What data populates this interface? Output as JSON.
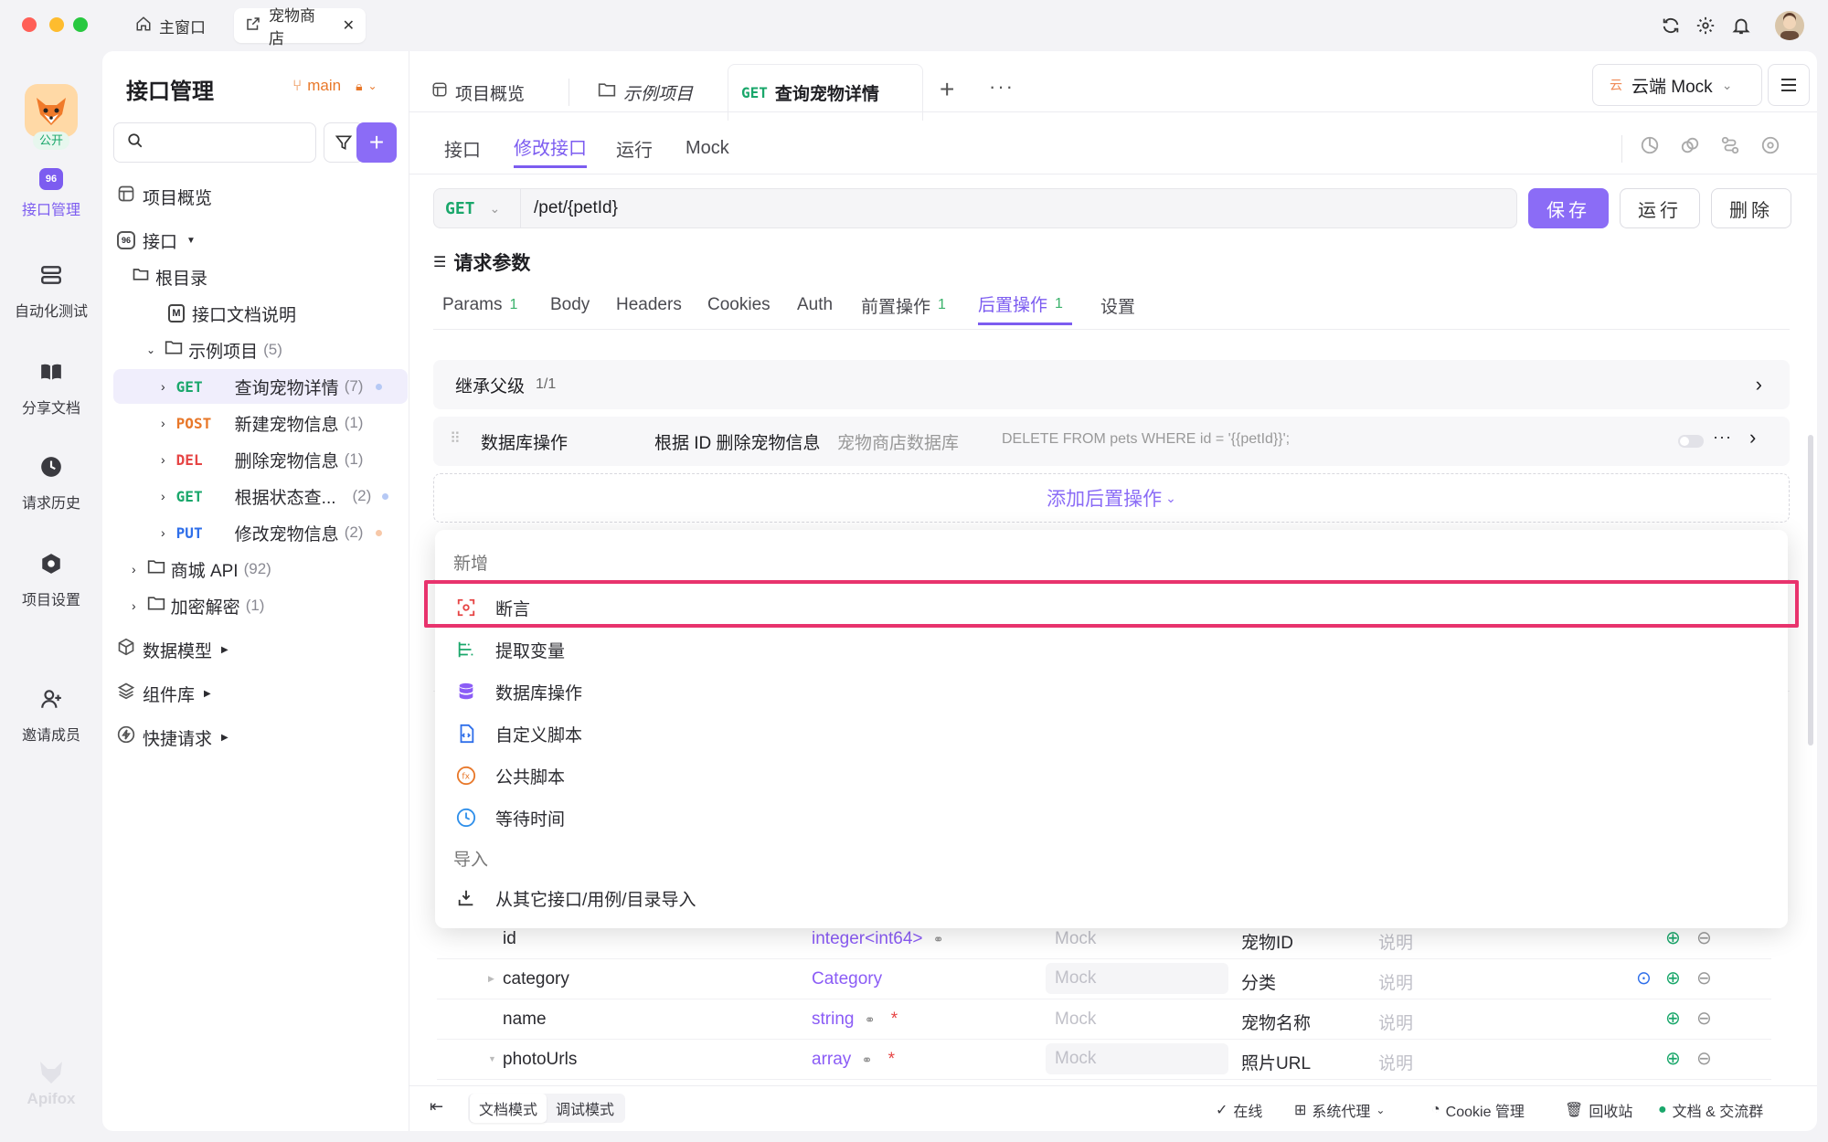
{
  "titlebar": {
    "tabs": [
      {
        "label": "主窗口",
        "icon": "home-icon"
      },
      {
        "label": "宠物商店",
        "icon": "external-link-icon",
        "active": true
      }
    ],
    "right_icons": [
      "refresh-icon",
      "gear-icon",
      "bell-icon",
      "avatar"
    ]
  },
  "rail": {
    "project_badge": "公开",
    "items": [
      {
        "label": "接口管理",
        "icon": "api-icon",
        "active": true
      },
      {
        "label": "自动化测试",
        "icon": "automation-icon"
      },
      {
        "label": "分享文档",
        "icon": "book-icon"
      },
      {
        "label": "请求历史",
        "icon": "clock-icon"
      },
      {
        "label": "项目设置",
        "icon": "settings-icon"
      },
      {
        "label": "邀请成员",
        "icon": "add-user-icon"
      }
    ],
    "brand": "Apifox"
  },
  "sidebar": {
    "title": "接口管理",
    "branch": "main",
    "search_placeholder": "",
    "tree": {
      "overview": "项目概览",
      "interfaces": "接口",
      "root": "根目录",
      "doc": "接口文档说明",
      "folder": {
        "label": "示例项目",
        "count": "(5)"
      },
      "endpoints": [
        {
          "method": "GET",
          "label": "查询宠物详情",
          "count": "(7)",
          "color": "#1aa76b"
        },
        {
          "method": "POST",
          "label": "新建宠物信息",
          "count": "(1)",
          "color": "#e8782a"
        },
        {
          "method": "DEL",
          "label": "删除宠物信息",
          "count": "(1)",
          "color": "#e64545"
        },
        {
          "method": "GET",
          "label": "根据状态查...",
          "count": "(2)",
          "color": "#1aa76b"
        },
        {
          "method": "PUT",
          "label": "修改宠物信息",
          "count": "(2)",
          "color": "#2f6fea"
        }
      ],
      "shop": {
        "label": "商城 API",
        "count": "(92)"
      },
      "crypto": {
        "label": "加密解密",
        "count": "(1)"
      },
      "models": "数据模型",
      "components": "组件库",
      "quick": "快捷请求"
    }
  },
  "main": {
    "tabs": [
      {
        "label": "项目概览"
      },
      {
        "label": "示例项目"
      },
      {
        "method": "GET",
        "label": "查询宠物详情",
        "active": true
      }
    ],
    "env": "云端 Mock",
    "env_badge": "云",
    "subtabs": [
      "接口",
      "修改接口",
      "运行",
      "Mock"
    ],
    "active_subtab": "修改接口",
    "request": {
      "method": "GET",
      "url": "/pet/{petId}",
      "save": "保存",
      "run": "运行",
      "delete": "删除"
    },
    "params_title": "请求参数",
    "param_tabs": [
      {
        "label": "Params",
        "count": "1"
      },
      {
        "label": "Body"
      },
      {
        "label": "Headers"
      },
      {
        "label": "Cookies"
      },
      {
        "label": "Auth"
      },
      {
        "label": "前置操作",
        "count": "1"
      },
      {
        "label": "后置操作",
        "count": "1",
        "active": true
      },
      {
        "label": "设置"
      }
    ],
    "inherit": {
      "label": "继承父级",
      "count": "1/1"
    },
    "db_op": {
      "label": "数据库操作",
      "name": "根据 ID 删除宠物信息",
      "db": "宠物商店数据库",
      "sql": "DELETE FROM pets WHERE id = '{{petId}}';"
    },
    "add_post": "添加后置操作",
    "menu": {
      "section_new": "新增",
      "items": [
        {
          "label": "断言",
          "icon": "assertion-icon",
          "color": "#e64545"
        },
        {
          "label": "提取变量",
          "icon": "extract-variable-icon",
          "color": "#1aa76b"
        },
        {
          "label": "数据库操作",
          "icon": "database-icon",
          "color": "#8b5cf6"
        },
        {
          "label": "自定义脚本",
          "icon": "script-icon",
          "color": "#2f6fea"
        },
        {
          "label": "公共脚本",
          "icon": "function-icon",
          "color": "#e8782a"
        },
        {
          "label": "等待时间",
          "icon": "clock-icon",
          "color": "#2f8fea"
        }
      ],
      "section_import": "导入",
      "import_item": "从其它接口/用例/目录导入"
    },
    "fields": [
      {
        "name": "id",
        "type": "integer<int64>",
        "mock": "Mock",
        "title": "宠物ID",
        "desc": "说明"
      },
      {
        "name": "category",
        "type": "Category",
        "mock": "Mock",
        "title": "分类",
        "desc": "说明"
      },
      {
        "name": "name",
        "type": "string",
        "mock": "Mock",
        "title": "宠物名称",
        "desc": "说明"
      },
      {
        "name": "photoUrls",
        "type": "array",
        "mock": "Mock",
        "title": "照片URL",
        "desc": "说明"
      }
    ],
    "required_mark": "*"
  },
  "statusbar": {
    "doc_mode": "文档模式",
    "debug_mode": "调试模式",
    "online": "在线",
    "proxy": "系统代理",
    "cookie": "Cookie 管理",
    "recycle": "回收站",
    "community": "文档 & 交流群"
  },
  "colors": {
    "accent": "#7c5cf0",
    "highlight_border": "#e8336d"
  }
}
